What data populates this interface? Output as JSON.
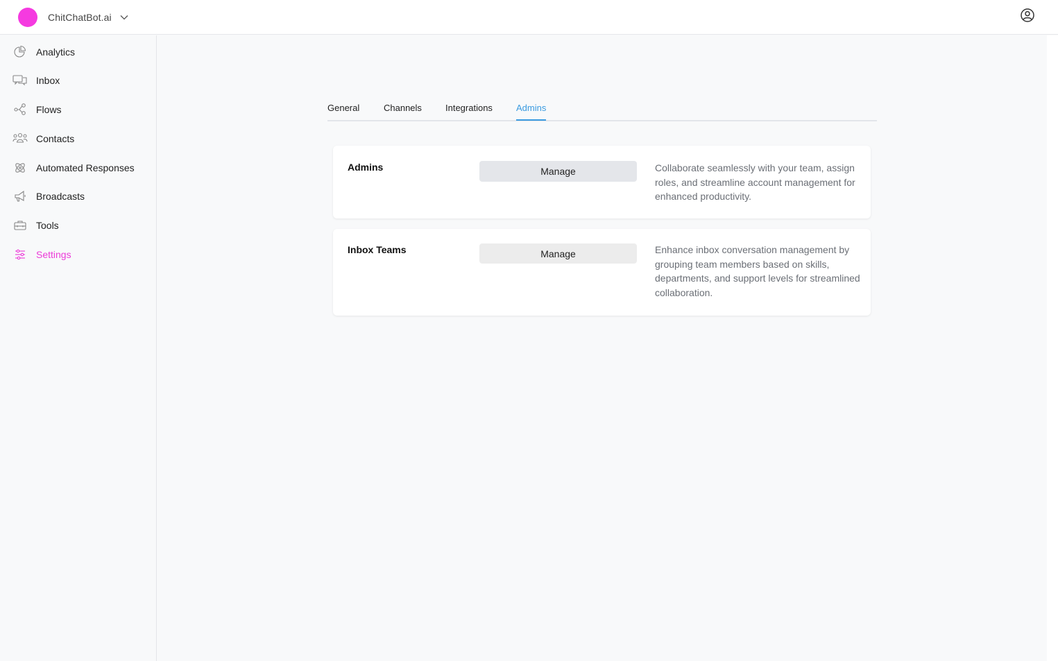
{
  "header": {
    "brand_name": "ChitChatBot.ai",
    "brand_color": "#f53ae0"
  },
  "sidebar": {
    "items": [
      {
        "label": "Analytics",
        "icon": "pie-chart-icon"
      },
      {
        "label": "Inbox",
        "icon": "chat-bubbles-icon"
      },
      {
        "label": "Flows",
        "icon": "flow-nodes-icon"
      },
      {
        "label": "Contacts",
        "icon": "users-icon"
      },
      {
        "label": "Automated Responses",
        "icon": "atom-icon"
      },
      {
        "label": "Broadcasts",
        "icon": "megaphone-icon"
      },
      {
        "label": "Tools",
        "icon": "toolbox-icon"
      },
      {
        "label": "Settings",
        "icon": "sliders-icon",
        "active": true
      }
    ],
    "active_color": "#ec3bd8"
  },
  "tabs": [
    {
      "label": "General"
    },
    {
      "label": "Channels"
    },
    {
      "label": "Integrations"
    },
    {
      "label": "Admins",
      "active": true
    }
  ],
  "tab_active_color": "#3b9be0",
  "cards": [
    {
      "title": "Admins",
      "button_label": "Manage",
      "description": "Collaborate seamlessly with your team, assign roles, and streamline account management for enhanced productivity."
    },
    {
      "title": "Inbox Teams",
      "button_label": "Manage",
      "description": "Enhance inbox conversation management by grouping team members based on skills, departments, and support levels for streamlined collaboration."
    }
  ]
}
